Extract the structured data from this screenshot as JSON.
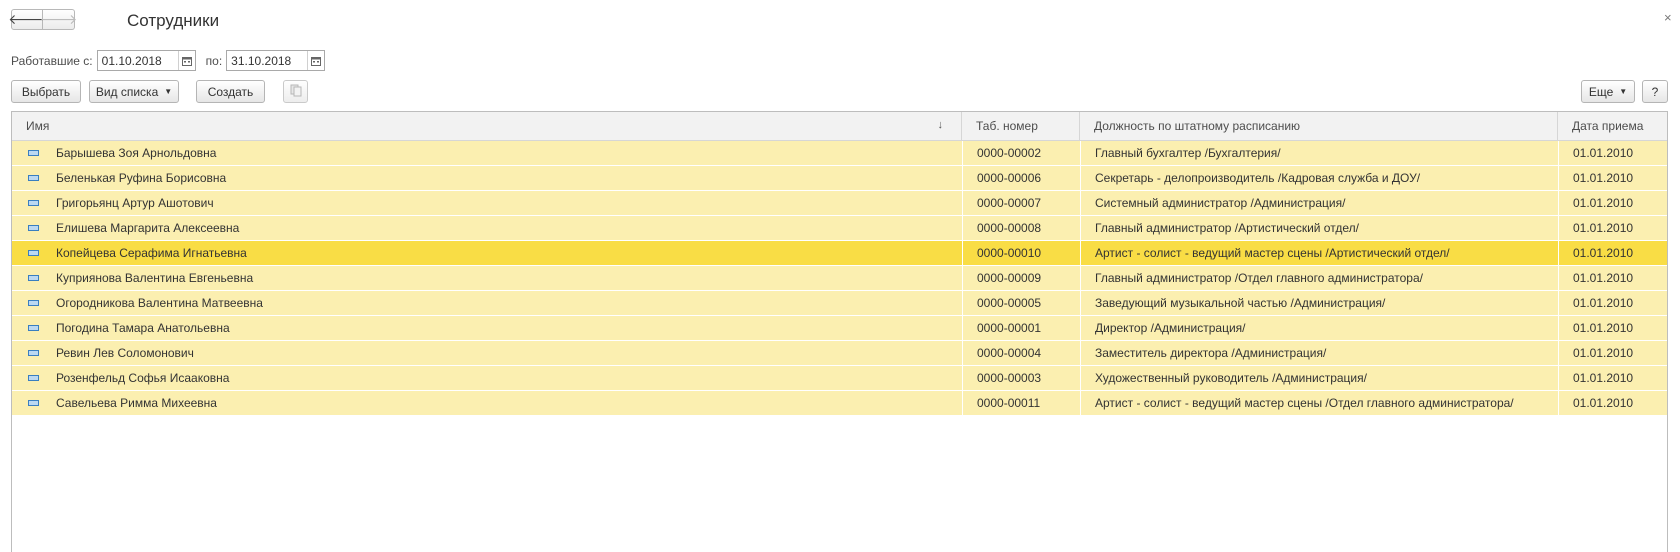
{
  "window": {
    "title": "Сотрудники",
    "close": "×"
  },
  "nav": {
    "back": "🡐",
    "forward": "🡒"
  },
  "filter": {
    "from_label": "Работавшие с:",
    "from_value": "01.10.2018",
    "to_label": "по:",
    "to_value": "31.10.2018"
  },
  "toolbar": {
    "select": "Выбрать",
    "list_view": "Вид списка",
    "create": "Создать",
    "more": "Еще",
    "help": "?"
  },
  "table": {
    "columns": [
      "Имя",
      "Таб. номер",
      "Должность по штатному расписанию",
      "Дата приема"
    ],
    "sort_indicator": "↓",
    "rows": [
      {
        "name": "Барышева Зоя Арнольдовна",
        "tab": "0000-00002",
        "position": "Главный бухгалтер /Бухгалтерия/",
        "date": "01.01.2010"
      },
      {
        "name": "Беленькая Руфина Борисовна",
        "tab": "0000-00006",
        "position": "Секретарь - делопроизводитель /Кадровая служба и ДОУ/",
        "date": "01.01.2010"
      },
      {
        "name": "Григорьянц Артур Ашотович",
        "tab": "0000-00007",
        "position": "Системный администратор /Администрация/",
        "date": "01.01.2010"
      },
      {
        "name": "Елишева Маргарита Алексеевна",
        "tab": "0000-00008",
        "position": "Главный администратор /Артистический отдел/",
        "date": "01.01.2010"
      },
      {
        "name": "Копейцева Серафима Игнатьевна",
        "tab": "0000-00010",
        "position": "Артист - солист - ведущий мастер сцены /Артистический отдел/",
        "date": "01.01.2010",
        "selected": true
      },
      {
        "name": "Куприянова Валентина Евгеньевна",
        "tab": "0000-00009",
        "position": "Главный администратор /Отдел главного администратора/",
        "date": "01.01.2010"
      },
      {
        "name": "Огородникова Валентина Матвеевна",
        "tab": "0000-00005",
        "position": "Заведующий музыкальной частью /Администрация/",
        "date": "01.01.2010"
      },
      {
        "name": "Погодина Тамара Анатольевна",
        "tab": "0000-00001",
        "position": "Директор /Администрация/",
        "date": "01.01.2010"
      },
      {
        "name": "Ревин Лев Соломонович",
        "tab": "0000-00004",
        "position": "Заместитель директора /Администрация/",
        "date": "01.01.2010"
      },
      {
        "name": "Розенфельд Софья Исааковна",
        "tab": "0000-00003",
        "position": "Художественный руководитель /Администрация/",
        "date": "01.01.2010"
      },
      {
        "name": "Савельева Римма Михеевна",
        "tab": "0000-00011",
        "position": "Артист - солист - ведущий мастер сцены /Отдел главного администратора/",
        "date": "01.01.2010"
      }
    ]
  }
}
